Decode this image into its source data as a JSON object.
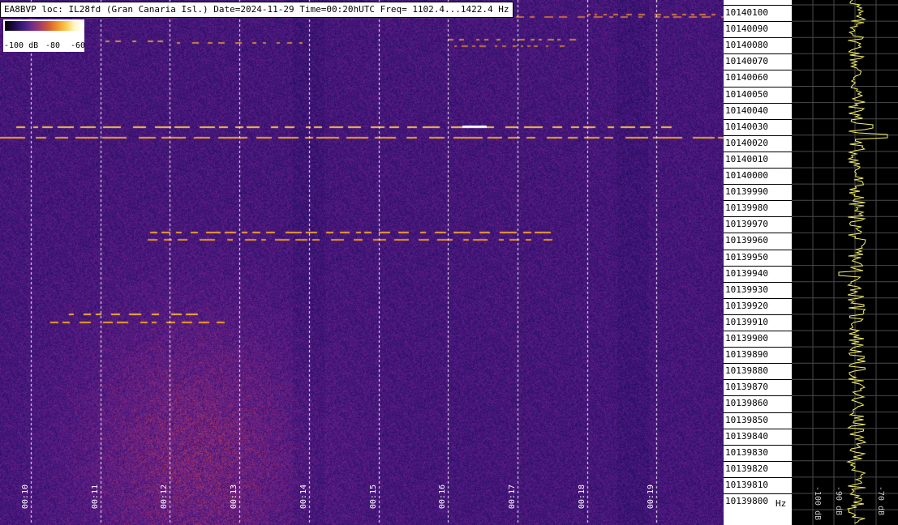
{
  "header": {
    "text": "EA8BVP loc: IL28fd (Gran Canaria Isl.) Date=2024-11-29 Time=00:20hUTC Freq= 1102.4...1422.4 Hz"
  },
  "legend": {
    "labels": [
      "-100 dB",
      "-80",
      "-60"
    ],
    "color_low": "#000000",
    "color_high": "#ffffff"
  },
  "time_axis": {
    "ticks": [
      "00:10",
      "00:11",
      "00:12",
      "00:13",
      "00:14",
      "00:15",
      "00:16",
      "00:17",
      "00:18",
      "00:19"
    ]
  },
  "freq_axis": {
    "labels": [
      "10140100",
      "10140090",
      "10140080",
      "10140070",
      "10140060",
      "10140050",
      "10140040",
      "10140030",
      "10140020",
      "10140010",
      "10140000",
      "10139990",
      "10139980",
      "10139970",
      "10139960",
      "10139950",
      "10139940",
      "10139930",
      "10139920",
      "10139910",
      "10139900",
      "10139890",
      "10139880",
      "10139870",
      "10139860",
      "10139850",
      "10139840",
      "10139830",
      "10139820",
      "10139810",
      "10139800"
    ],
    "unit": "Hz"
  },
  "spectrum_panel": {
    "labels": [
      "-100 dB",
      "-90 dB",
      "-70 dB"
    ],
    "trace_color": "#f5f06a",
    "background": "#000000"
  }
}
